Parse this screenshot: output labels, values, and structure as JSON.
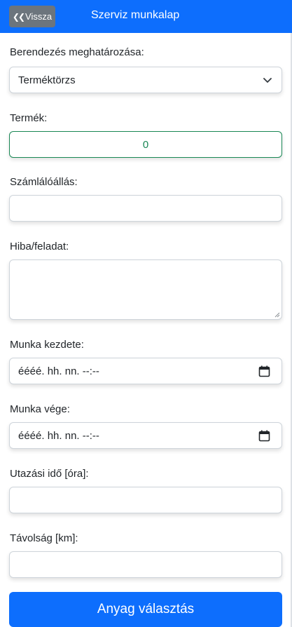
{
  "header": {
    "back_label": "Vissza",
    "back_icon": "double-chevron-left-icon",
    "title": "Szerviz munkalap"
  },
  "form": {
    "device_label": "Berendezés meghatározása:",
    "device_value": "Terméktörzs",
    "product_label": "Termék:",
    "product_value": "0",
    "counter_label": "Számlálóállás:",
    "counter_value": "",
    "issue_label": "Hiba/feladat:",
    "issue_value": "",
    "start_label": "Munka kezdete:",
    "start_value": "éééé. hh. nn. --:--",
    "end_label": "Munka vége:",
    "end_value": "éééé. hh. nn. --:--",
    "travel_label": "Utazási idő [óra]:",
    "travel_value": "",
    "distance_label": "Távolság [km]:",
    "distance_value": ""
  },
  "actions": {
    "materials_label": "Anyag választás"
  },
  "colors": {
    "primary": "#0d6efd",
    "secondary": "#6c757d",
    "success": "#198754"
  }
}
